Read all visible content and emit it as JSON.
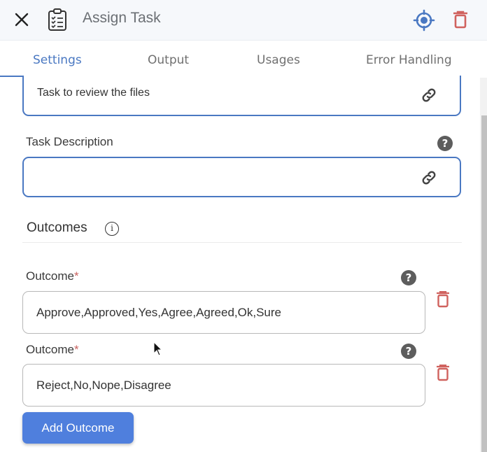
{
  "header": {
    "title": "Assign Task",
    "icons": {
      "close": "close-icon",
      "task": "clipboard-checklist-icon",
      "target": "crosshair-target-icon",
      "delete": "trash-icon"
    },
    "colors": {
      "accent": "#4a78c2",
      "danger": "#d0625e"
    }
  },
  "tabs": [
    {
      "label": "Settings",
      "active": true
    },
    {
      "label": "Output",
      "active": false
    },
    {
      "label": "Usages",
      "active": false
    },
    {
      "label": "Error Handling",
      "active": false
    }
  ],
  "form": {
    "task_name": {
      "value": "Task to review the files",
      "icon": "link-icon"
    },
    "task_description": {
      "label": "Task Description",
      "value": "",
      "help": "?",
      "icon": "link-icon"
    },
    "outcomes_section": {
      "title": "Outcomes",
      "info": "i"
    },
    "outcomes": [
      {
        "label": "Outcome",
        "required_mark": "*",
        "help": "?",
        "value": "Approve,Approved,Yes,Agree,Agreed,Ok,Sure"
      },
      {
        "label": "Outcome",
        "required_mark": "*",
        "help": "?",
        "value": "Reject,No,Nope,Disagree"
      }
    ],
    "add_outcome_label": "Add Outcome"
  }
}
